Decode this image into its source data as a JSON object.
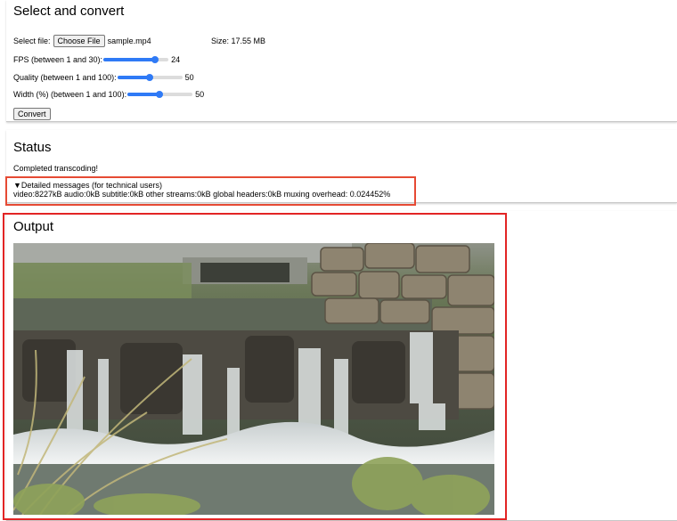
{
  "select_section": {
    "title": "Select and convert",
    "file": {
      "label": "Select file:",
      "button_label": "Choose File",
      "filename": "sample.mp4",
      "size_text": "Size: 17.55 MB"
    },
    "sliders": [
      {
        "label": "FPS (between 1 and 30):",
        "value": "24",
        "fraction": 0.793
      },
      {
        "label": "Quality (between 1 and 100):",
        "value": "50",
        "fraction": 0.495
      },
      {
        "label": "Width (%) (between 1 and 100):",
        "value": "50",
        "fraction": 0.495
      }
    ],
    "convert_label": "Convert"
  },
  "status_section": {
    "title": "Status",
    "message": "Completed transcoding!",
    "details_summary": "▼Detailed messages (for technical users)",
    "details_text": "video:8227kB audio:0kB subtitle:0kB other streams:0kB global headers:0kB muxing overhead: 0.024452%"
  },
  "output_section": {
    "title": "Output"
  },
  "colors": {
    "accent": "#2f7af6",
    "highlight_details": "#e64a34",
    "highlight_output": "#e22424"
  }
}
